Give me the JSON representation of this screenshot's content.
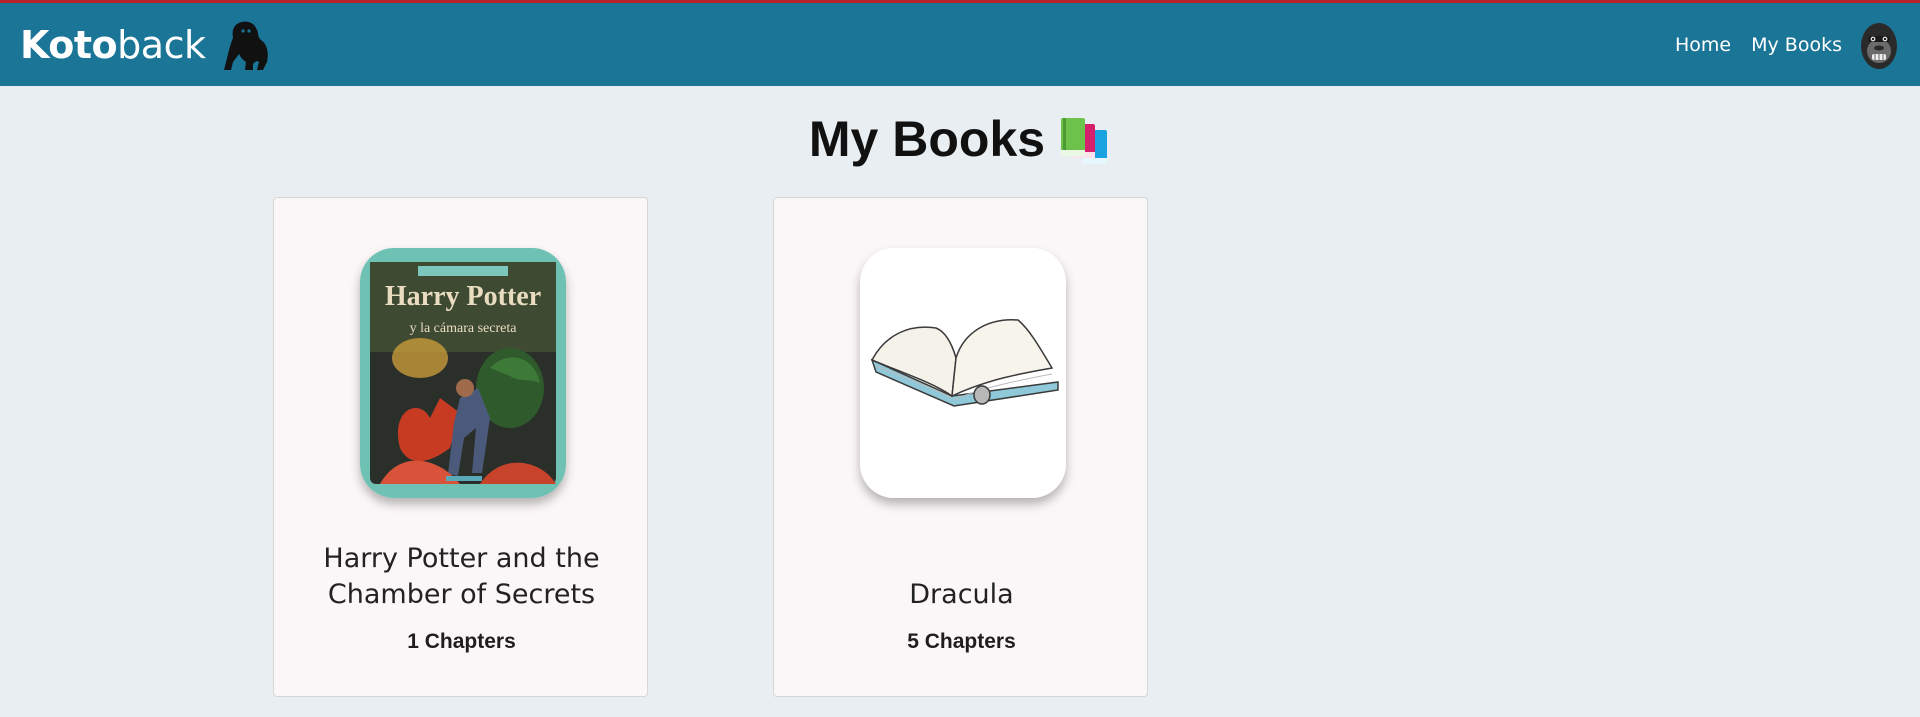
{
  "brand": {
    "bold": "Koto",
    "light": "back",
    "logo_icon": "gorilla-icon"
  },
  "nav": {
    "links": [
      "Home",
      "My Books"
    ],
    "avatar_icon": "gorilla-face-icon"
  },
  "page": {
    "title": "My Books",
    "title_icon": "books-icon"
  },
  "books": [
    {
      "title": "Harry Potter and the Chamber of Secrets",
      "chapters": "1 Chapters",
      "cover_text": "Harry Potter",
      "cover_subtext": "y la cámara secreta"
    },
    {
      "title": "Dracula",
      "chapters": "5 Chapters",
      "cover_icon": "open-book-icon"
    }
  ],
  "colors": {
    "navbar": "#1b7597",
    "top_accent": "#b5222c",
    "background": "#e9eef2",
    "card": "#fbf6f7"
  }
}
